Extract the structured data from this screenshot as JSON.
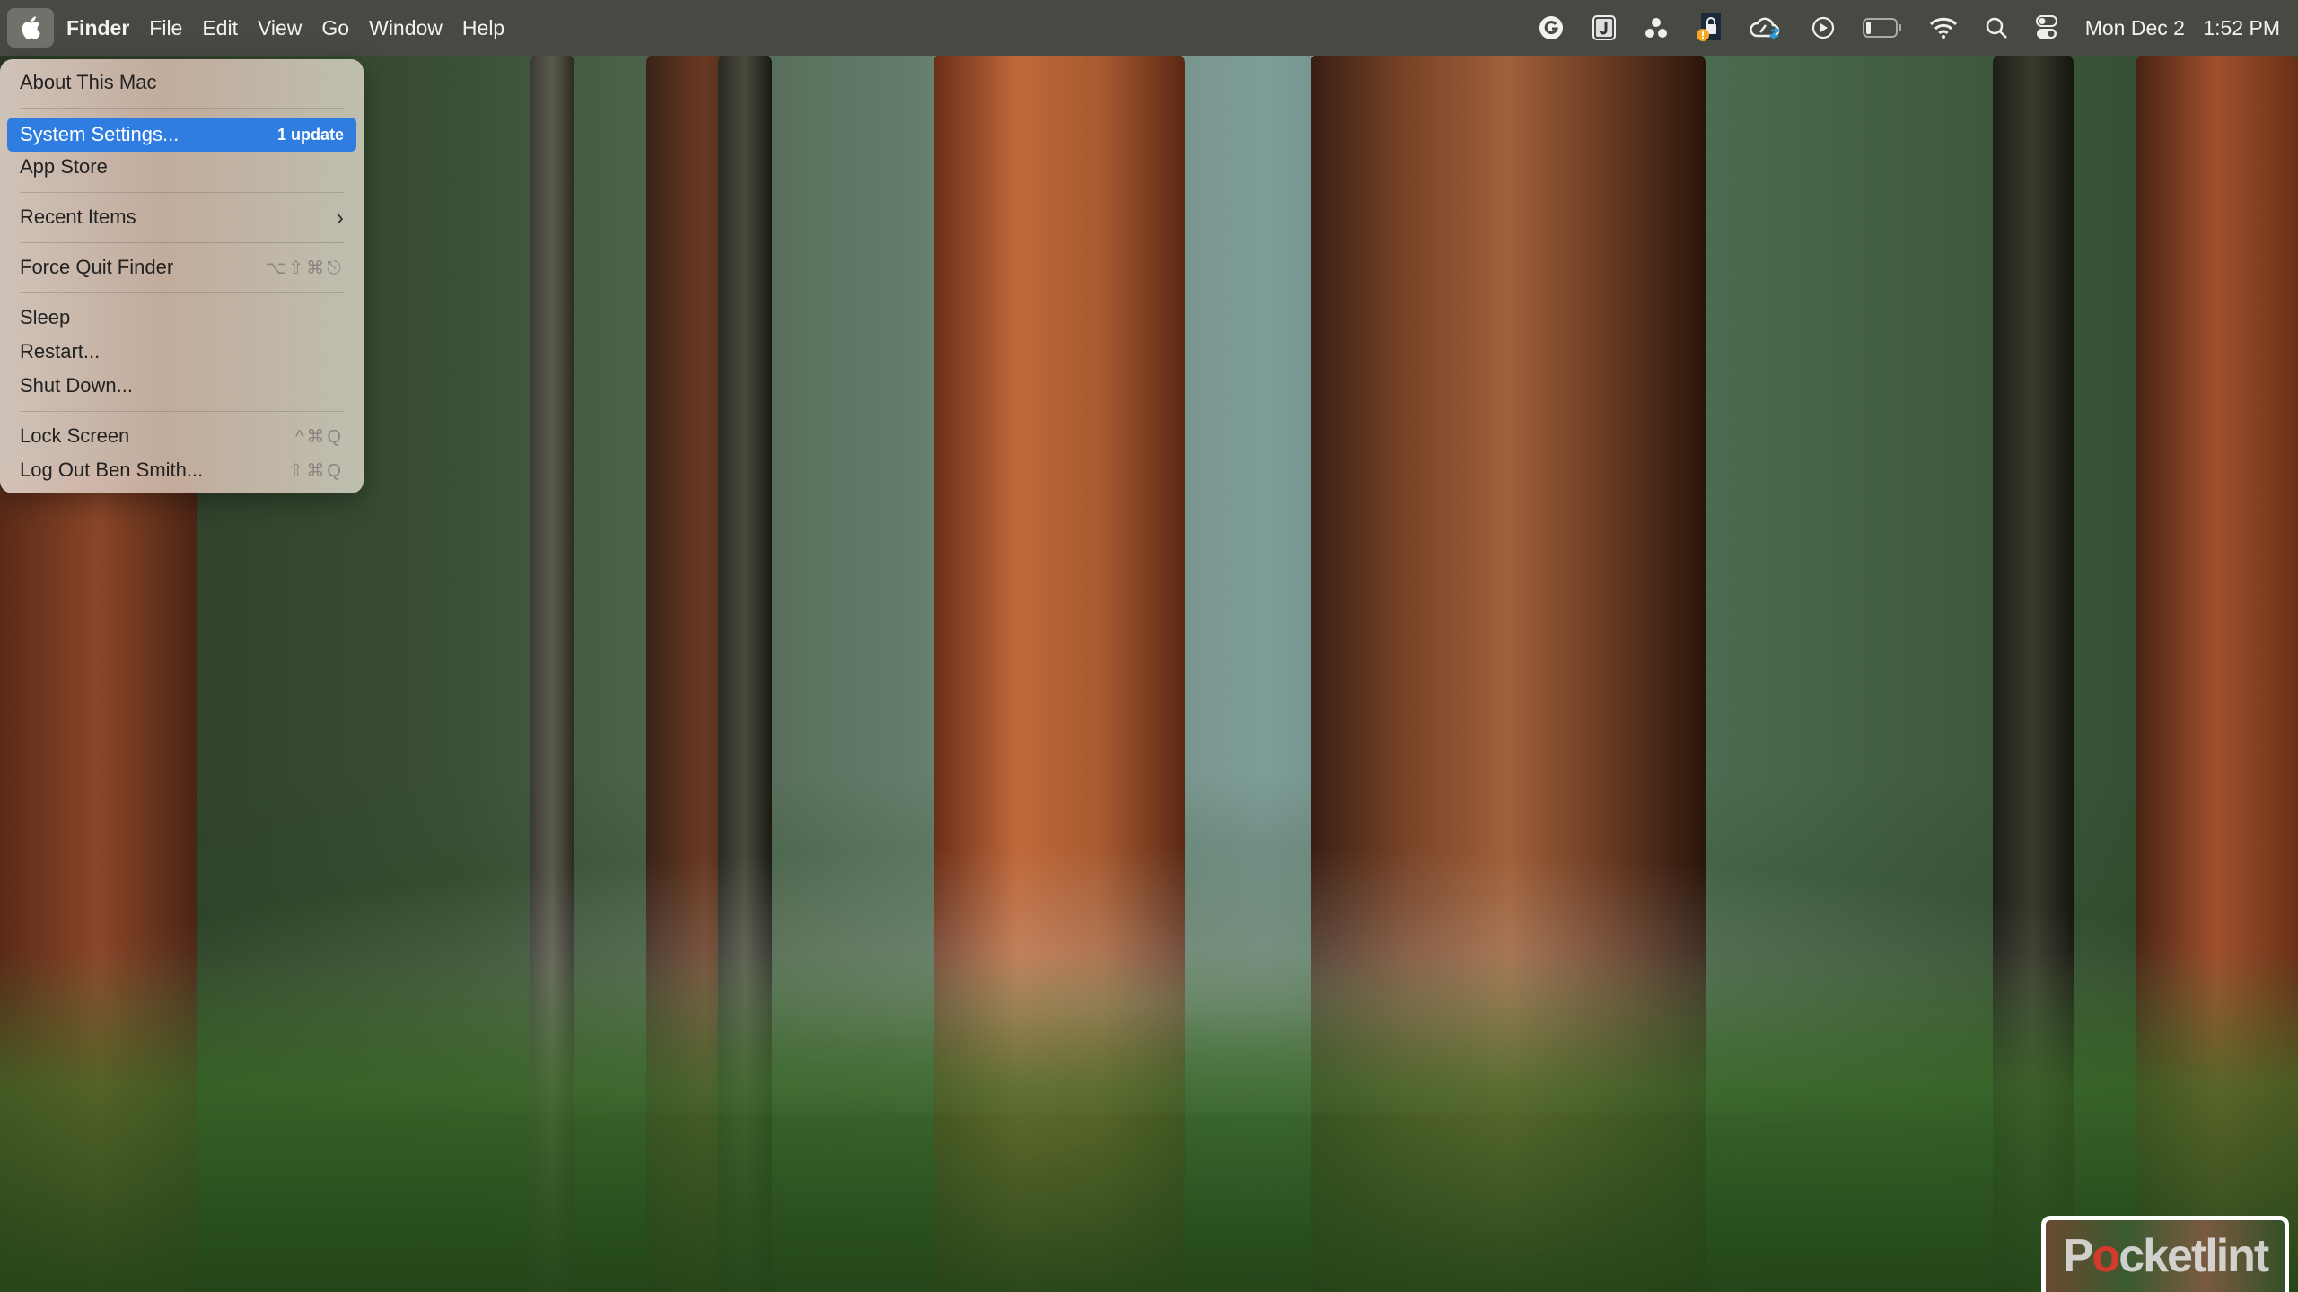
{
  "menubar": {
    "app_name": "Finder",
    "menus": [
      "File",
      "Edit",
      "View",
      "Go",
      "Window",
      "Help"
    ],
    "status_icons": [
      "grammarly-icon",
      "jira-icon",
      "tripod-dots-icon",
      "lock-warning-icon",
      "creative-cloud-sync-icon",
      "play-circle-icon",
      "battery-icon",
      "wifi-icon",
      "search-icon",
      "control-center-icon"
    ],
    "date": "Mon Dec 2",
    "time": "1:52 PM"
  },
  "apple_menu": {
    "items": [
      {
        "label": "About This Mac"
      },
      {
        "label": "System Settings...",
        "badge": "1 update",
        "highlighted": true
      },
      {
        "label": "App Store"
      },
      {
        "label": "Recent Items",
        "submenu": true
      },
      {
        "label": "Force Quit Finder",
        "shortcut": "⌥⇧⌘⎋"
      },
      {
        "label": "Sleep"
      },
      {
        "label": "Restart..."
      },
      {
        "label": "Shut Down..."
      },
      {
        "label": "Lock Screen",
        "shortcut": "^⌘Q"
      },
      {
        "label": "Log Out Ben Smith...",
        "shortcut": "⇧⌘Q"
      }
    ]
  },
  "watermark": {
    "text_pre": "P",
    "text_o": "o",
    "text_post": "cketlint"
  },
  "colors": {
    "highlight": "#2f7de1",
    "menubar": "#474a42"
  }
}
